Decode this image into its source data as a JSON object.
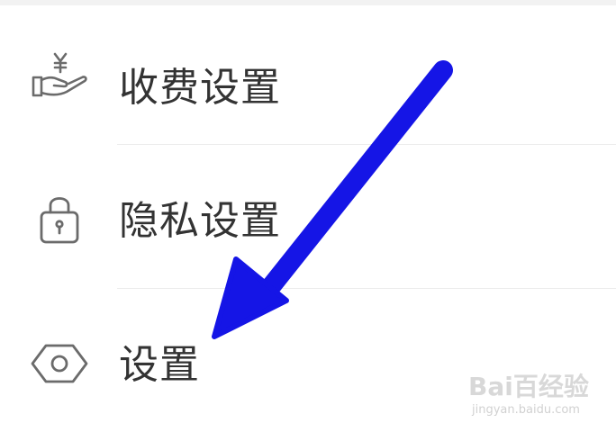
{
  "menu": {
    "items": [
      {
        "label": "收费设置",
        "icon": "hand-yen-icon"
      },
      {
        "label": "隐私设置",
        "icon": "lock-icon"
      },
      {
        "label": "设置",
        "icon": "hexagon-gear-icon"
      }
    ]
  },
  "annotation": {
    "arrow_color": "#1515e6",
    "arrow_target": "settings"
  },
  "watermark": {
    "brand": "Bai百经验",
    "url": "jingyan.baidu.com"
  },
  "colors": {
    "text": "#333333",
    "icon": "#6b6b6b",
    "divider": "#ececec",
    "background": "#ffffff"
  }
}
